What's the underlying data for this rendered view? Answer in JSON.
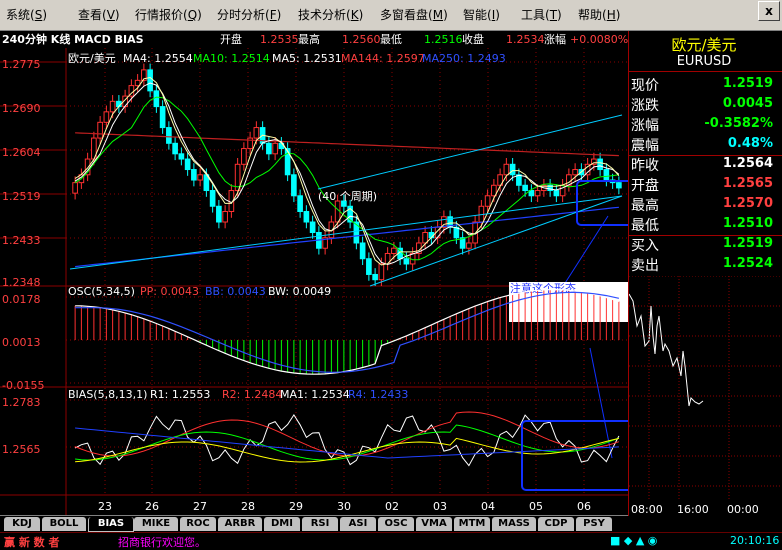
{
  "menu": {
    "items": [
      {
        "label": "系统",
        "key": "S"
      },
      {
        "label": "查看",
        "key": "V"
      },
      {
        "label": "行情报价",
        "key": "Q"
      },
      {
        "label": "分时分析",
        "key": "F"
      },
      {
        "label": "技术分析",
        "key": "K"
      },
      {
        "label": "多窗看盘",
        "key": "M"
      },
      {
        "label": "智能",
        "key": "I"
      },
      {
        "label": "工具",
        "key": "T"
      },
      {
        "label": "帮助",
        "key": "H"
      }
    ],
    "close": "x"
  },
  "header": {
    "title": "240分钟 K线 MACD BIAS",
    "open_label": "开盘",
    "open": "1.2535",
    "high_label": "最高",
    "high": "1.2560",
    "low_label": "最低",
    "low": "1.2516",
    "close_label": "收盘",
    "close": "1.2534",
    "change_label": "涨幅",
    "change": "+0.0080%"
  },
  "main_panel": {
    "label": "欧元/美元",
    "indicators": [
      {
        "name": "MA4",
        "value": "1.2554",
        "color": "#ffffff"
      },
      {
        "name": "MA10",
        "value": "1.2514",
        "color": "#00ff00"
      },
      {
        "name": "MA5",
        "value": "1.2531",
        "color": "#ffffff"
      },
      {
        "name": "MA144",
        "value": "1.2597",
        "color": "#ff4040"
      },
      {
        "name": "MA250",
        "value": "1.2493",
        "color": "#3050ff"
      }
    ],
    "y_ticks": [
      "1.2775",
      "1.2690",
      "1.2604",
      "1.2519",
      "1.2433",
      "1.2348"
    ],
    "annotation_period": "(40 个周期)",
    "annotation_note": "注意这个形态"
  },
  "osc_panel": {
    "label": "OSC(5,34,5)",
    "pp": "PP: 0.0043",
    "bb": "BB: 0.0043",
    "bw": "BW: 0.0049",
    "y_ticks": [
      "0.0178",
      "0.0013",
      "-0.0155"
    ]
  },
  "bias_panel": {
    "label": "BIAS(5,8,13,1)",
    "r1": "R1: 1.2553",
    "r2": "R2: 1.2484",
    "ma1": "MA1: 1.2534",
    "r4": "R4: 1.2433",
    "y_ticks": [
      "1.2783",
      "1.2565"
    ]
  },
  "x_ticks": [
    "23",
    "26",
    "27",
    "28",
    "29",
    "30",
    "02",
    "03",
    "04",
    "05",
    "06"
  ],
  "quote": {
    "name": "欧元/美元",
    "code": "EURUSD",
    "rows": [
      {
        "label": "现价",
        "value": "1.2519",
        "color": "#00ff00"
      },
      {
        "label": "涨跌",
        "value": "0.0045",
        "color": "#00ff00"
      },
      {
        "label": "涨幅",
        "value": "-0.3582%",
        "color": "#00ff00"
      },
      {
        "label": "震幅",
        "value": "0.48%",
        "color": "#00ffff"
      },
      {
        "label": "昨收",
        "value": "1.2564",
        "color": "#ffffff"
      },
      {
        "label": "开盘",
        "value": "1.2565",
        "color": "#ff4040"
      },
      {
        "label": "最高",
        "value": "1.2570",
        "color": "#ff4040"
      },
      {
        "label": "最低",
        "value": "1.2510",
        "color": "#00ff00"
      },
      {
        "label": "买入",
        "value": "1.2519",
        "color": "#00ff00"
      },
      {
        "label": "卖出",
        "value": "1.2524",
        "color": "#00ff00"
      }
    ],
    "time_ticks": [
      "08:00",
      "16:00",
      "00:00"
    ]
  },
  "tabs": [
    "KDJ",
    "BOLL",
    "BIAS",
    "MIKE",
    "ROC",
    "ARBR",
    "DMI",
    "RSI",
    "ASI",
    "OSC",
    "VMA",
    "MTM",
    "MASS",
    "CDP",
    "PSY"
  ],
  "active_tab": "BIAS",
  "status": {
    "logo": "赢 新 数 者",
    "message": "招商银行欢迎您。",
    "time": "20:10:16"
  },
  "colors": {
    "grid": "#8b0000",
    "up": "#ff3030",
    "down": "#00ffff",
    "menu_bg": "#d4d0c8"
  }
}
